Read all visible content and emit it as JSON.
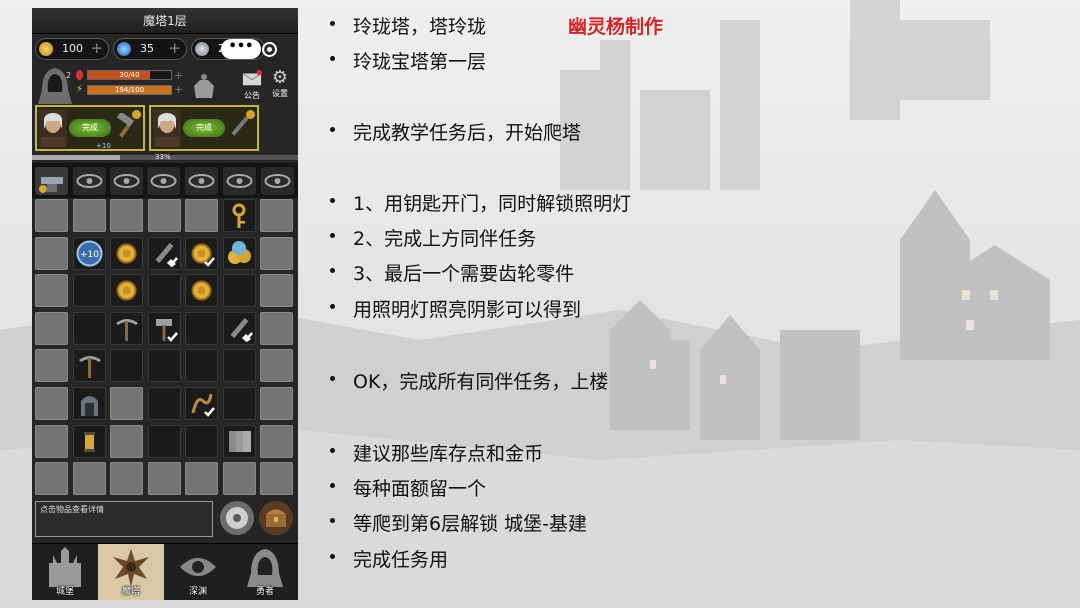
{
  "game": {
    "floor_title": "魔塔1层",
    "resources": [
      {
        "icon": "gold-coin-icon",
        "value": "100"
      },
      {
        "icon": "blue-gem-icon",
        "value": "35"
      },
      {
        "icon": "silver-token-icon",
        "value": "24"
      }
    ],
    "capsule_dots": "•••",
    "hp_bar": {
      "text": "30/40",
      "fraction": 0.75,
      "color": "#c8521c"
    },
    "energy_bar": {
      "text": "194/100",
      "fraction": 1.0,
      "color": "#c8731c"
    },
    "notice_label": "公告",
    "settings_label": "设置",
    "quests": [
      {
        "status": "完成",
        "reward": ""
      },
      {
        "status": "完成",
        "reward": "+10"
      }
    ],
    "progress": {
      "text": "33%",
      "fraction": 0.33
    },
    "info_text": "点击物品查看详情",
    "nav": [
      {
        "label": "城堡",
        "active": false
      },
      {
        "label": "魔塔",
        "active": true
      },
      {
        "label": "深渊",
        "active": false
      },
      {
        "label": "勇者",
        "active": false
      }
    ]
  },
  "notes": {
    "author": "幽灵杨制作",
    "bullets": [
      "玲珑塔，塔玲珑",
      "玲珑宝塔第一层",
      "完成教学任务后，开始爬塔",
      "1、用钥匙开门，同时解锁照明灯",
      "2、完成上方同伴任务",
      "3、最后一个需要齿轮零件",
      "用照明灯照亮阴影可以得到",
      "OK，完成所有同伴任务，上楼",
      "建议那些库存点和金币",
      "每种面额留一个",
      "等爬到第6层解锁 城堡-基建",
      "完成任务用"
    ]
  },
  "colors": {
    "accent_red": "#e02020",
    "quest_border": "#c7b23c",
    "coin": "#d9a72a"
  }
}
